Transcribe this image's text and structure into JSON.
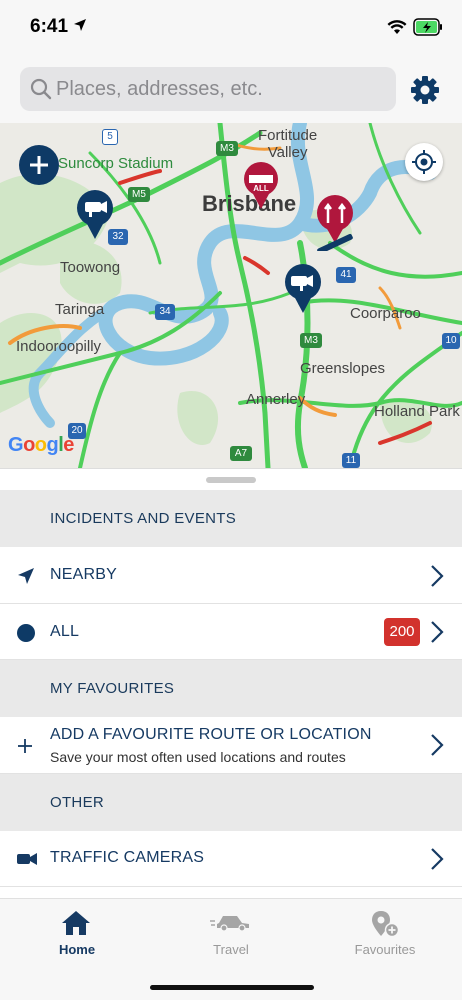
{
  "status_bar": {
    "time": "6:41"
  },
  "search": {
    "placeholder": "Places, addresses, etc."
  },
  "map": {
    "labels": {
      "fortitude_valley": "Fortitude\nValley",
      "suncorp_stadium": "Suncorp Stadium",
      "brisbane": "Brisbane",
      "toowong": "Toowong",
      "taringa": "Taringa",
      "indooroopilly": "Indooroopilly",
      "coorparoo": "Coorparoo",
      "greenslopes": "Greenslopes",
      "annerley": "Annerley",
      "holland_park": "Holland Park"
    },
    "road_shields": [
      "5",
      "M3",
      "M5",
      "32",
      "41",
      "34",
      "M3",
      "10",
      "20",
      "A7",
      "11"
    ],
    "marker_all_text": "ALL",
    "attribution": "Google"
  },
  "sections": {
    "incidents_header": "INCIDENTS AND EVENTS",
    "nearby_label": "NEARBY",
    "all_label": "ALL",
    "all_count": "200",
    "favourites_header": "MY FAVOURITES",
    "add_favourite_label": "ADD A FAVOURITE ROUTE OR LOCATION",
    "add_favourite_sub": "Save your most often used locations and routes",
    "other_header": "OTHER",
    "traffic_cameras_label": "TRAFFIC CAMERAS"
  },
  "tabs": [
    {
      "label": "Home",
      "icon": "home-icon",
      "active": true
    },
    {
      "label": "Travel",
      "icon": "car-icon",
      "active": false
    },
    {
      "label": "Favourites",
      "icon": "location-plus-icon",
      "active": false
    }
  ],
  "colors": {
    "brand": "#0e3a66",
    "badge": "#d2322d",
    "traffic_green": "#4fcf5a",
    "traffic_orange": "#f29b3b",
    "traffic_red": "#d9362c",
    "river": "#8fc6e4"
  }
}
